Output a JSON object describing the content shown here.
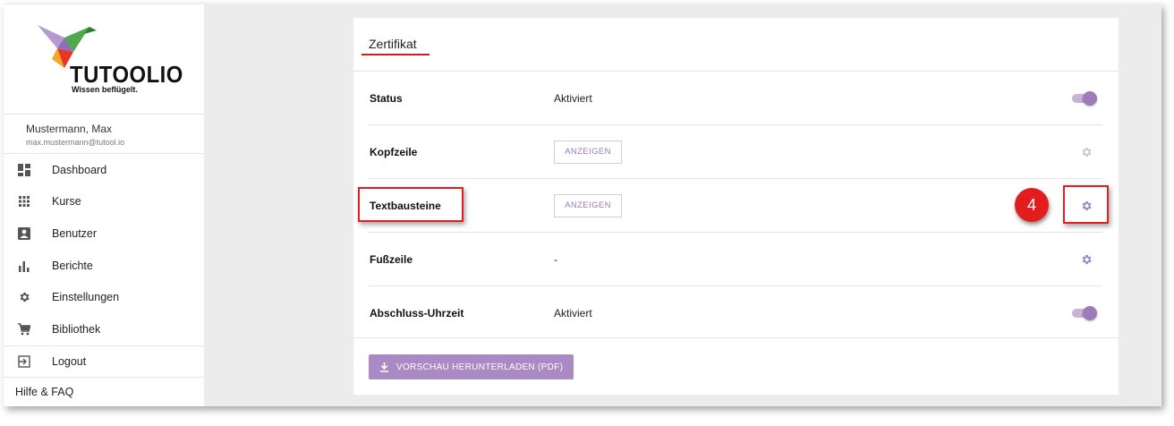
{
  "brand": {
    "name": "TUTOOLIO",
    "tagline": "Wissen beflügelt."
  },
  "user": {
    "name": "Mustermann, Max",
    "email": "max.mustermann@tutool.io"
  },
  "sidebar": {
    "items": [
      {
        "label": "Dashboard",
        "icon": "dashboard-icon"
      },
      {
        "label": "Kurse",
        "icon": "apps-grid-icon"
      },
      {
        "label": "Benutzer",
        "icon": "user-card-icon"
      },
      {
        "label": "Berichte",
        "icon": "bar-chart-icon"
      },
      {
        "label": "Einstellungen",
        "icon": "gear-icon"
      },
      {
        "label": "Bibliothek",
        "icon": "cart-icon"
      }
    ],
    "logout": {
      "label": "Logout",
      "icon": "logout-icon"
    },
    "help": "Hilfe & FAQ"
  },
  "main": {
    "title": "Zertifikat",
    "rows": [
      {
        "label": "Status",
        "value": "Aktiviert",
        "control": "toggle-on"
      },
      {
        "label": "Kopfzeile",
        "button": "ANZEIGEN",
        "control": "gear-disabled"
      },
      {
        "label": "Textbausteine",
        "button": "ANZEIGEN",
        "control": "gear-active"
      },
      {
        "label": "Fußzeile",
        "value": "-",
        "control": "gear-active"
      },
      {
        "label": "Abschluss-Uhrzeit",
        "value": "Aktiviert",
        "control": "toggle-on"
      }
    ],
    "download_button": "VORSCHAU HERUNTERLADEN (PDF)"
  },
  "annotation": {
    "step_number": "4"
  },
  "colors": {
    "accent": "#a98ac4",
    "toggle_knob": "#9b7cb8",
    "highlight": "#e02020",
    "title_underline": "#cc1f1f"
  }
}
